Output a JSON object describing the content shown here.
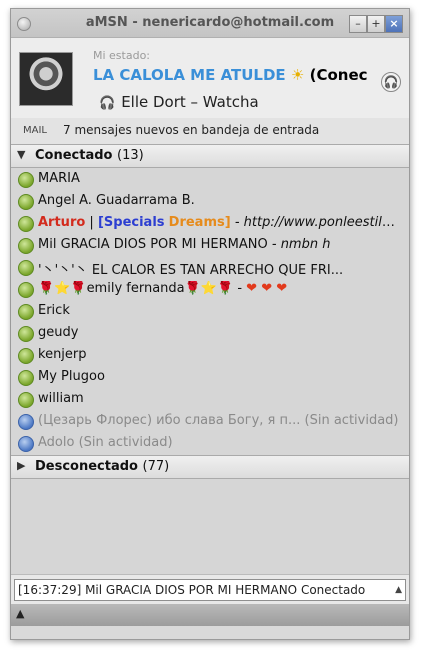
{
  "window": {
    "title": "aMSN - nenericardo@hotmail.com",
    "min": "–",
    "max": "+",
    "close": "×"
  },
  "header": {
    "status_label": "Mi estado:",
    "nick": "LA CALOLA ME ATULDE",
    "nick_sun": "☀",
    "nick_tail": "(Conec",
    "music": "Elle Dort – Watcha"
  },
  "mail": {
    "label": "MAIL",
    "text": "7 mensajes nuevos en bandeja de entrada"
  },
  "groups": {
    "online": {
      "name": "Conectado",
      "count": "(13)"
    },
    "offline": {
      "name": "Desconectado",
      "count": "(77)"
    }
  },
  "contacts": [
    {
      "name": "MARIA"
    },
    {
      "name": "Angel A. Guadarrama B."
    },
    {
      "name_a": "Arturo",
      "sep": " | ",
      "name_b": "[Specials",
      "name_c": "Dreams]",
      "psm": " - http://www.ponleestiloat..."
    },
    {
      "name": "Mil GRACIA  DIOS POR MI HERMANO",
      "psm": " - nmbn h"
    },
    {
      "name": "'丶'丶'丶 EL CALOR ES TAN ARRECHO QUE FRI..."
    },
    {
      "name": "emily fernanda",
      "deco_pre": "🌹⭐🌹",
      "deco_post": "🌹⭐🌹",
      "dash": " - ",
      "hearts": "❤ ❤ ❤"
    },
    {
      "name": "Erick"
    },
    {
      "name": "geudy"
    },
    {
      "name": "kenjerp"
    },
    {
      "name": "My Plugoo"
    },
    {
      "name": "william"
    },
    {
      "name": "(Цезарь Флорес) ибо слава Богу, я п... (Sin actividad)"
    },
    {
      "name": "Adolo (Sin actividad)"
    }
  ],
  "now_playing": {
    "text": "[16:37:29] Mil GRACIA  DIOS POR MI HERMANO Conectado"
  },
  "footer": {
    "arrow": "▲"
  }
}
